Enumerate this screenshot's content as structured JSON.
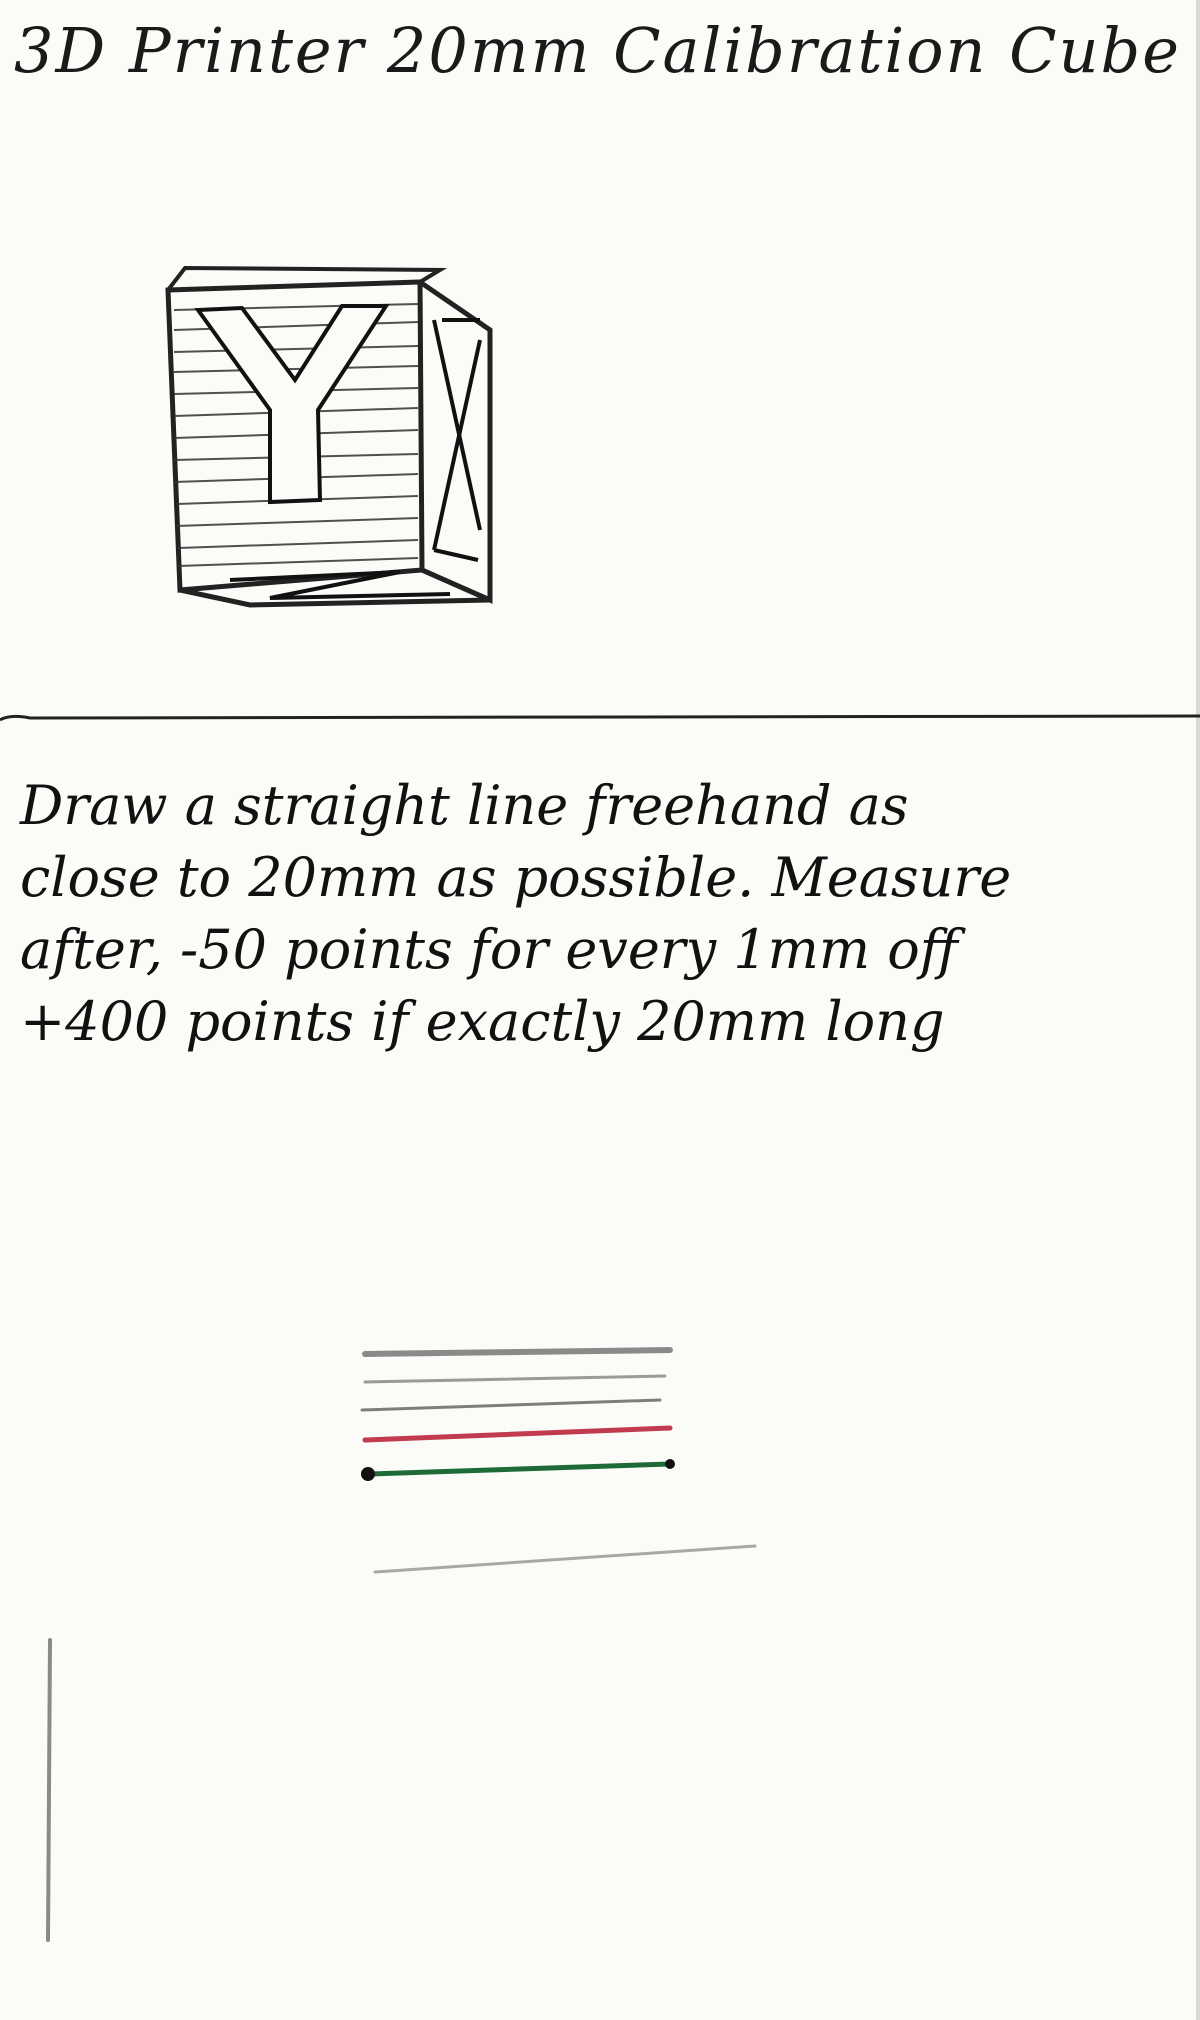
{
  "title": "3D Printer 20mm Calibration Cube",
  "cube": {
    "front_letter": "Y",
    "side_letter": "X",
    "bottom_letter": "Z"
  },
  "instructions": {
    "lines": [
      "Draw a straight line freehand as",
      "close to 20mm as possible. Measure",
      "after, -50 points for every 1mm off",
      "+400 points if exactly 20mm long"
    ]
  },
  "drawn_lines": {
    "colors": [
      "#8a8a8a",
      "#9a9a9a",
      "#7d7d7d",
      "#c23a4e",
      "#1e6b37",
      "#a8a8a8"
    ]
  }
}
